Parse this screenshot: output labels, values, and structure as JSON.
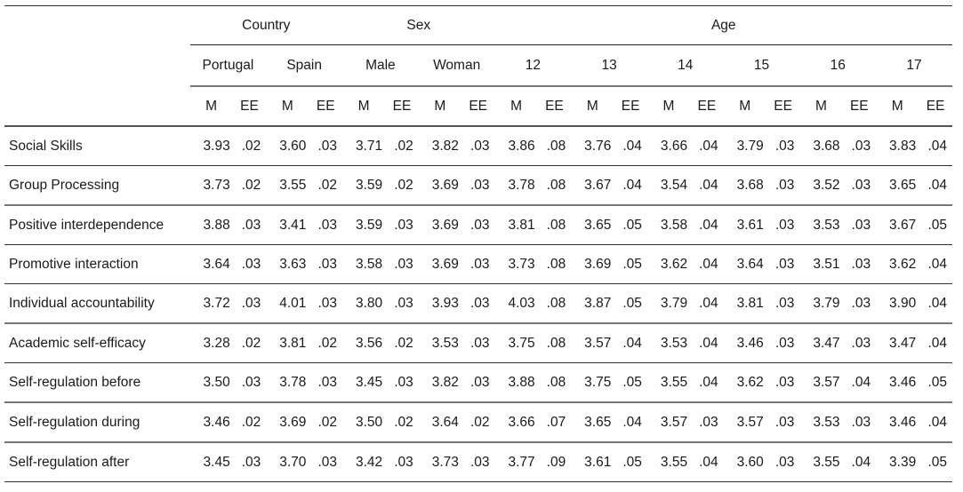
{
  "table": {
    "group_headers": [
      {
        "label": "Country",
        "span": 2
      },
      {
        "label": "Sex",
        "span": 2
      },
      {
        "label": "Age",
        "span": 6
      }
    ],
    "sub_headers": [
      "Portugal",
      "Spain",
      "Male",
      "Woman",
      "12",
      "13",
      "14",
      "15",
      "16",
      "17"
    ],
    "stat_headers": {
      "mean": "M",
      "error": "EE"
    },
    "rows": [
      {
        "label": "Social Skills",
        "values": [
          [
            "3.93",
            ".02"
          ],
          [
            "3.60",
            ".03"
          ],
          [
            "3.71",
            ".02"
          ],
          [
            "3.82",
            ".03"
          ],
          [
            "3.86",
            ".08"
          ],
          [
            "3.76",
            ".04"
          ],
          [
            "3.66",
            ".04"
          ],
          [
            "3.79",
            ".03"
          ],
          [
            "3.68",
            ".03"
          ],
          [
            "3.83",
            ".04"
          ]
        ]
      },
      {
        "label": "Group Processing",
        "values": [
          [
            "3.73",
            ".02"
          ],
          [
            "3.55",
            ".02"
          ],
          [
            "3.59",
            ".02"
          ],
          [
            "3.69",
            ".03"
          ],
          [
            "3.78",
            ".08"
          ],
          [
            "3.67",
            ".04"
          ],
          [
            "3.54",
            ".04"
          ],
          [
            "3.68",
            ".03"
          ],
          [
            "3.52",
            ".03"
          ],
          [
            "3.65",
            ".04"
          ]
        ]
      },
      {
        "label": "Positive interdependence",
        "values": [
          [
            "3.88",
            ".03"
          ],
          [
            "3.41",
            ".03"
          ],
          [
            "3.59",
            ".03"
          ],
          [
            "3.69",
            ".03"
          ],
          [
            "3.81",
            ".08"
          ],
          [
            "3.65",
            ".05"
          ],
          [
            "3.58",
            ".04"
          ],
          [
            "3.61",
            ".03"
          ],
          [
            "3.53",
            ".03"
          ],
          [
            "3.67",
            ".05"
          ]
        ]
      },
      {
        "label": "Promotive interaction",
        "values": [
          [
            "3.64",
            ".03"
          ],
          [
            "3.63",
            ".03"
          ],
          [
            "3.58",
            ".03"
          ],
          [
            "3.69",
            ".03"
          ],
          [
            "3.73",
            ".08"
          ],
          [
            "3.69",
            ".05"
          ],
          [
            "3.62",
            ".04"
          ],
          [
            "3.64",
            ".03"
          ],
          [
            "3.51",
            ".03"
          ],
          [
            "3.62",
            ".04"
          ]
        ]
      },
      {
        "label": "Individual accountability",
        "values": [
          [
            "3.72",
            ".03"
          ],
          [
            "4.01",
            ".03"
          ],
          [
            "3.80",
            ".03"
          ],
          [
            "3.93",
            ".03"
          ],
          [
            "4.03",
            ".08"
          ],
          [
            "3.87",
            ".05"
          ],
          [
            "3.79",
            ".04"
          ],
          [
            "3.81",
            ".03"
          ],
          [
            "3.79",
            ".03"
          ],
          [
            "3.90",
            ".04"
          ]
        ]
      },
      {
        "label": "Academic self-efficacy",
        "values": [
          [
            "3.28",
            ".02"
          ],
          [
            "3.81",
            ".02"
          ],
          [
            "3.56",
            ".02"
          ],
          [
            "3.53",
            ".03"
          ],
          [
            "3.75",
            ".08"
          ],
          [
            "3.57",
            ".04"
          ],
          [
            "3.53",
            ".04"
          ],
          [
            "3.46",
            ".03"
          ],
          [
            "3.47",
            ".03"
          ],
          [
            "3.47",
            ".04"
          ]
        ]
      },
      {
        "label": "Self-regulation before",
        "values": [
          [
            "3.50",
            ".03"
          ],
          [
            "3.78",
            ".03"
          ],
          [
            "3.45",
            ".03"
          ],
          [
            "3.82",
            ".03"
          ],
          [
            "3.88",
            ".08"
          ],
          [
            "3.75",
            ".05"
          ],
          [
            "3.55",
            ".04"
          ],
          [
            "3.62",
            ".03"
          ],
          [
            "3.57",
            ".04"
          ],
          [
            "3.46",
            ".05"
          ]
        ]
      },
      {
        "label": "Self-regulation during",
        "values": [
          [
            "3.46",
            ".02"
          ],
          [
            "3.69",
            ".02"
          ],
          [
            "3.50",
            ".02"
          ],
          [
            "3.64",
            ".02"
          ],
          [
            "3.66",
            ".07"
          ],
          [
            "3.65",
            ".04"
          ],
          [
            "3.57",
            ".03"
          ],
          [
            "3.57",
            ".03"
          ],
          [
            "3.53",
            ".03"
          ],
          [
            "3.46",
            ".04"
          ]
        ]
      },
      {
        "label": "Self-regulation after",
        "values": [
          [
            "3.45",
            ".03"
          ],
          [
            "3.70",
            ".03"
          ],
          [
            "3.42",
            ".03"
          ],
          [
            "3.73",
            ".03"
          ],
          [
            "3.77",
            ".09"
          ],
          [
            "3.61",
            ".05"
          ],
          [
            "3.55",
            ".04"
          ],
          [
            "3.60",
            ".03"
          ],
          [
            "3.55",
            ".04"
          ],
          [
            "3.39",
            ".05"
          ]
        ]
      }
    ]
  }
}
